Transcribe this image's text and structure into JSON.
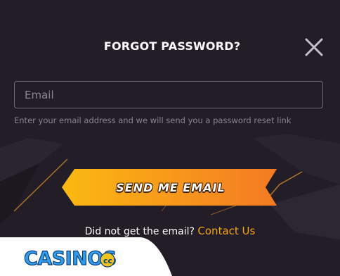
{
  "modal": {
    "title": "FORGOT PASSWORD?",
    "close_icon": "close-icon"
  },
  "form": {
    "email_placeholder": "Email",
    "email_value": "",
    "helper_text": "Enter your email address and we will send you a password reset link",
    "submit_label": "SEND ME EMAIL"
  },
  "footer": {
    "prompt_text": "Did not get the email?",
    "contact_link": "Contact Us"
  },
  "watermark": {
    "logo_text": "CASINOS.cc"
  },
  "colors": {
    "background": "#221d27",
    "accent": "#f2a516",
    "button_gradient_start": "#fbb910",
    "button_gradient_end": "#f47a24",
    "watermark_blue": "#2f9ef0",
    "watermark_gold": "#f2c21d"
  }
}
